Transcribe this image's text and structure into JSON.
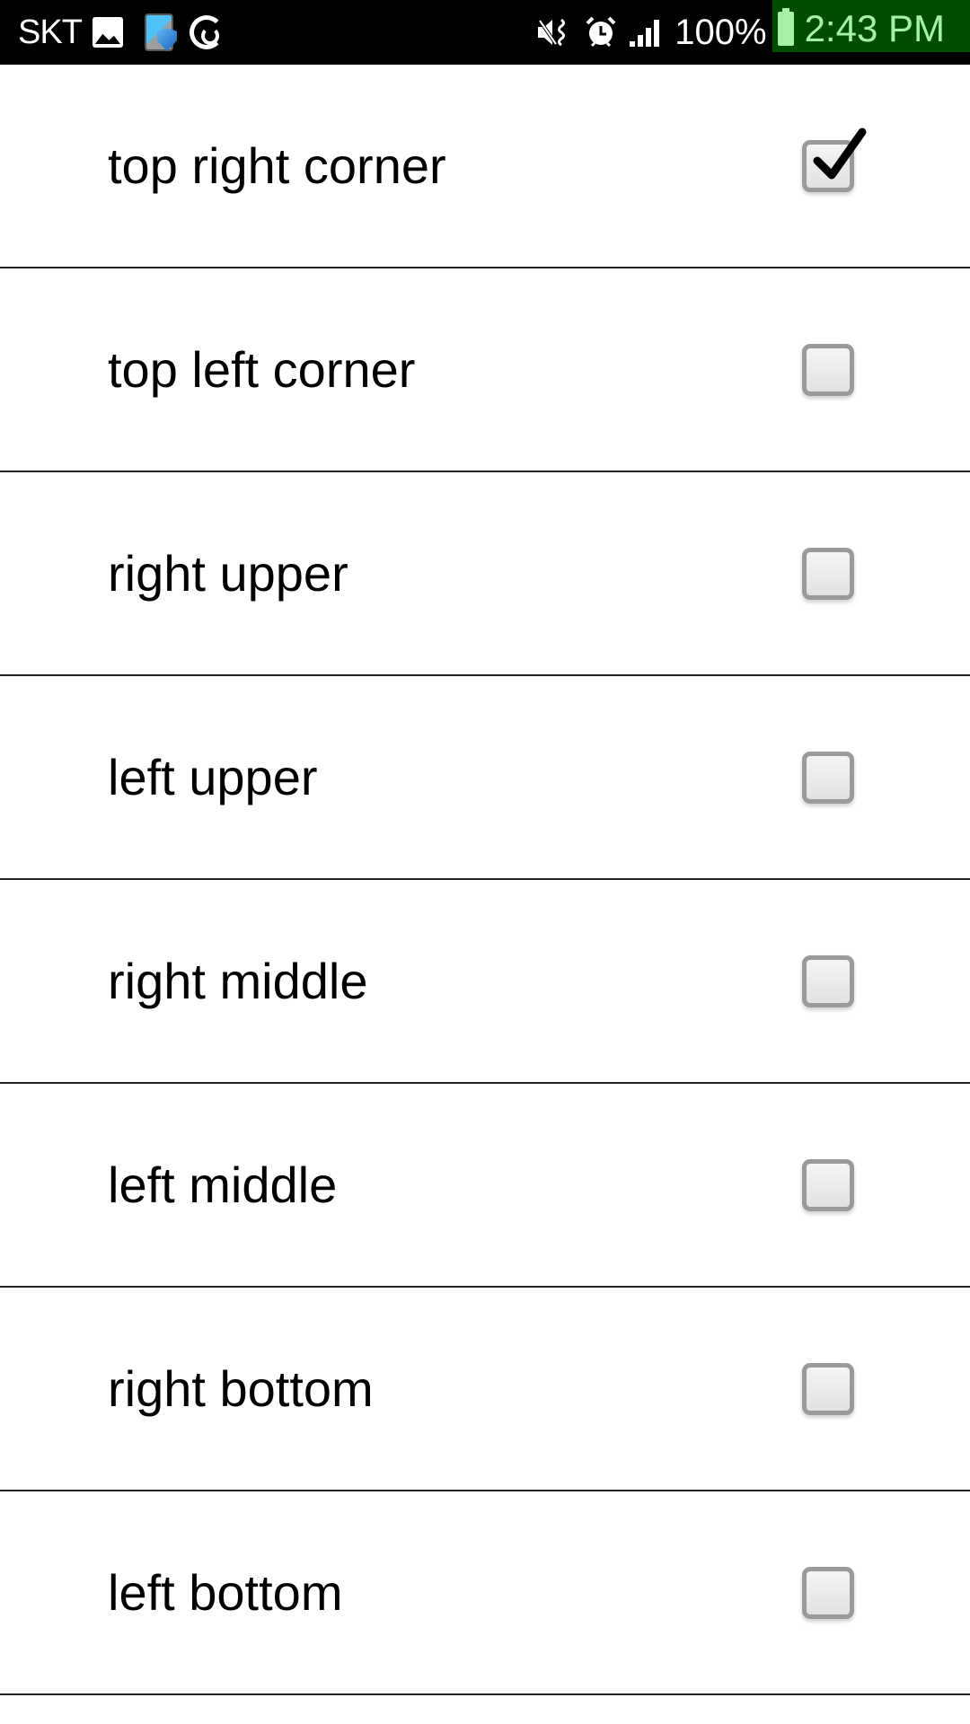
{
  "status_bar": {
    "carrier": "SKT",
    "left_icons": [
      "gallery-icon",
      "security-shield-icon",
      "sync-icon"
    ],
    "right_icons": [
      "mute-vibrate-icon",
      "alarm-icon",
      "signal-icon"
    ],
    "battery_percent": "100%",
    "battery_icon": "battery-full-icon",
    "time": "2:43 PM",
    "time_highlight_color": "#004d00",
    "time_text_color": "#a8f0a8"
  },
  "list": {
    "items": [
      {
        "label": "top right corner",
        "checked": true
      },
      {
        "label": "top left corner",
        "checked": false
      },
      {
        "label": "right upper",
        "checked": false
      },
      {
        "label": "left upper",
        "checked": false
      },
      {
        "label": "right middle",
        "checked": false
      },
      {
        "label": "left middle",
        "checked": false
      },
      {
        "label": "right bottom",
        "checked": false
      },
      {
        "label": "left bottom",
        "checked": false
      }
    ]
  }
}
